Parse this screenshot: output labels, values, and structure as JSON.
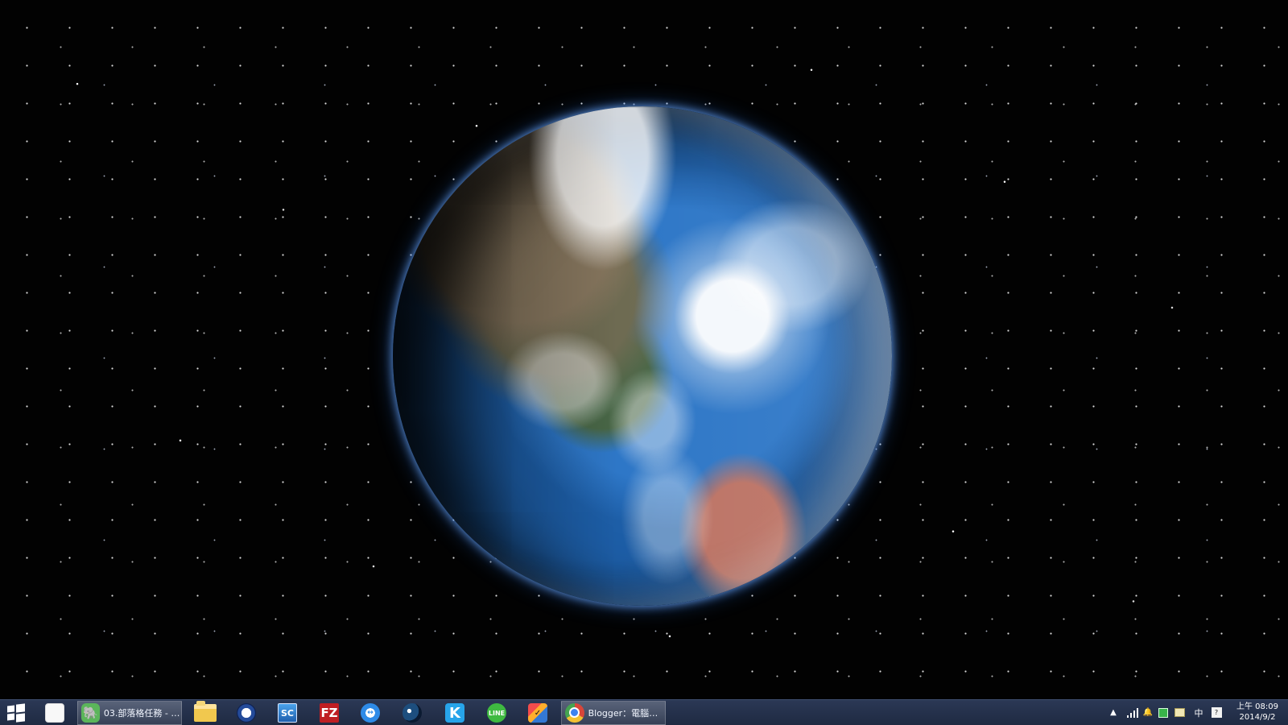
{
  "desktop": {
    "background": "space-earth-wallpaper"
  },
  "taskbar": {
    "start_icon": "windows-start-icon",
    "items": [
      {
        "icon": "apps-grid-icon"
      },
      {
        "icon": "evernote-icon",
        "label": "03.部落格任務 - e..."
      },
      {
        "icon": "folder-icon"
      },
      {
        "icon": "lock-icon"
      },
      {
        "icon": "sc-monitor-icon",
        "text": "SC"
      },
      {
        "icon": "filezilla-icon",
        "text": "FZ"
      },
      {
        "icon": "teamviewer-icon",
        "text": "↔"
      },
      {
        "icon": "steam-icon"
      },
      {
        "icon": "k-app-icon",
        "text": "K"
      },
      {
        "icon": "line-icon",
        "text": "LINE"
      },
      {
        "icon": "colorful-tool-icon",
        "text": "✓"
      },
      {
        "icon": "chrome-icon",
        "label": "Blogger：電腦玩..."
      }
    ]
  },
  "system_tray": {
    "arrow": "▲",
    "input_language": "中",
    "box_icon": "?",
    "clock_time": "上午 08:09",
    "clock_date": "2014/9/2",
    "bell": "🔔"
  },
  "colors": {
    "taskbar": "#22304a",
    "earth_glow": "#5c9cff"
  }
}
